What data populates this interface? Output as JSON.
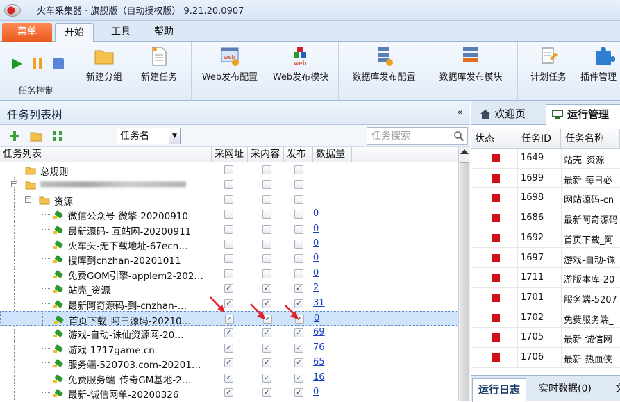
{
  "window": {
    "title": "火车采集器 · 旗舰版（自动授权版） 9.21.20.0907"
  },
  "ribbon_tabs": [
    "菜单",
    "开始",
    "工具",
    "帮助"
  ],
  "ribbon": {
    "control_group_label": "任务控制",
    "buttons": [
      "新建分组",
      "新建任务",
      "Web发布配置",
      "Web发布模块",
      "数据库发布配置",
      "数据库发布模块",
      "计划任务",
      "插件管理"
    ]
  },
  "left": {
    "title": "任务列表树",
    "collapse": "«",
    "combo_value": "任务名",
    "search_placeholder": "任务搜索",
    "columns": [
      "任务列表",
      "采网址",
      "采内容",
      "发布",
      "数据量"
    ],
    "rows": [
      {
        "name": "总规则",
        "level": 1,
        "type": "folder",
        "cb": [
          false,
          false,
          false
        ],
        "count": ""
      },
      {
        "name": "",
        "level": 1,
        "type": "folder",
        "cb": [
          false,
          false,
          false
        ],
        "count": "",
        "redacted": true
      },
      {
        "name": "资源",
        "level": 2,
        "type": "folder",
        "cb": [
          false,
          false,
          false
        ],
        "count": ""
      },
      {
        "name": "微信公众号-微擎-20200910",
        "level": 3,
        "type": "task",
        "cb": [
          false,
          false,
          false
        ],
        "count": "0"
      },
      {
        "name": "最新源码- 互站网-20200911",
        "level": 3,
        "type": "task",
        "cb": [
          false,
          false,
          false
        ],
        "count": "0"
      },
      {
        "name": "火车头-无下载地址-67ecn…",
        "level": 3,
        "type": "task",
        "cb": [
          false,
          false,
          false
        ],
        "count": "0"
      },
      {
        "name": "搜库到cnzhan-20201011",
        "level": 3,
        "type": "task",
        "cb": [
          false,
          false,
          false
        ],
        "count": "0"
      },
      {
        "name": "免费GOM引擎-applem2-202…",
        "level": 3,
        "type": "task",
        "cb": [
          false,
          false,
          false
        ],
        "count": "0"
      },
      {
        "name": "站壳_资源",
        "level": 3,
        "type": "task",
        "cb": [
          true,
          true,
          true
        ],
        "count": "2"
      },
      {
        "name": "最新阿奇源码-到-cnzhan-…",
        "level": 3,
        "type": "task",
        "cb": [
          true,
          true,
          true
        ],
        "count": "31"
      },
      {
        "name": "首页下载_阿三源码-20210…",
        "level": 3,
        "type": "task",
        "cb": [
          true,
          true,
          true
        ],
        "count": "0",
        "selected": true
      },
      {
        "name": "游戏-自动-诛仙资源网-20…",
        "level": 3,
        "type": "task",
        "cb": [
          true,
          true,
          true
        ],
        "count": "69"
      },
      {
        "name": "游戏-1717game.cn",
        "level": 3,
        "type": "task",
        "cb": [
          true,
          true,
          true
        ],
        "count": "76"
      },
      {
        "name": "服务端-520703.com-20201…",
        "level": 3,
        "type": "task",
        "cb": [
          true,
          true,
          true
        ],
        "count": "65"
      },
      {
        "name": "免费服务端_传奇GM基地-2…",
        "level": 3,
        "type": "task",
        "cb": [
          true,
          true,
          true
        ],
        "count": "16"
      },
      {
        "name": "最新-诚信网单-20200326",
        "level": 3,
        "type": "task",
        "cb": [
          true,
          true,
          true
        ],
        "count": "0"
      }
    ]
  },
  "right": {
    "tabs": [
      "欢迎页",
      "运行管理"
    ],
    "columns": [
      "状态",
      "任务ID",
      "任务名称"
    ],
    "rows": [
      {
        "id": "1649",
        "name": "站壳_资源"
      },
      {
        "id": "1699",
        "name": "最新-每日必"
      },
      {
        "id": "1698",
        "name": "网站源码-cn"
      },
      {
        "id": "1686",
        "name": "最新阿奇源码"
      },
      {
        "id": "1692",
        "name": "首页下载_阿"
      },
      {
        "id": "1697",
        "name": "游戏-自动-诛"
      },
      {
        "id": "1711",
        "name": "游版本库-20"
      },
      {
        "id": "1701",
        "name": "服务端-5207"
      },
      {
        "id": "1702",
        "name": "免费服务端_"
      },
      {
        "id": "1705",
        "name": "最新-诚信网"
      },
      {
        "id": "1706",
        "name": "最新-热血侠"
      }
    ],
    "bottom_tabs": [
      "运行日志",
      "实时数据(0)",
      "文"
    ]
  },
  "colors": {
    "stopped": "#d0111a",
    "accent": "#e85a1e",
    "link": "#1a3fbf",
    "arrow": "#e0202a"
  }
}
